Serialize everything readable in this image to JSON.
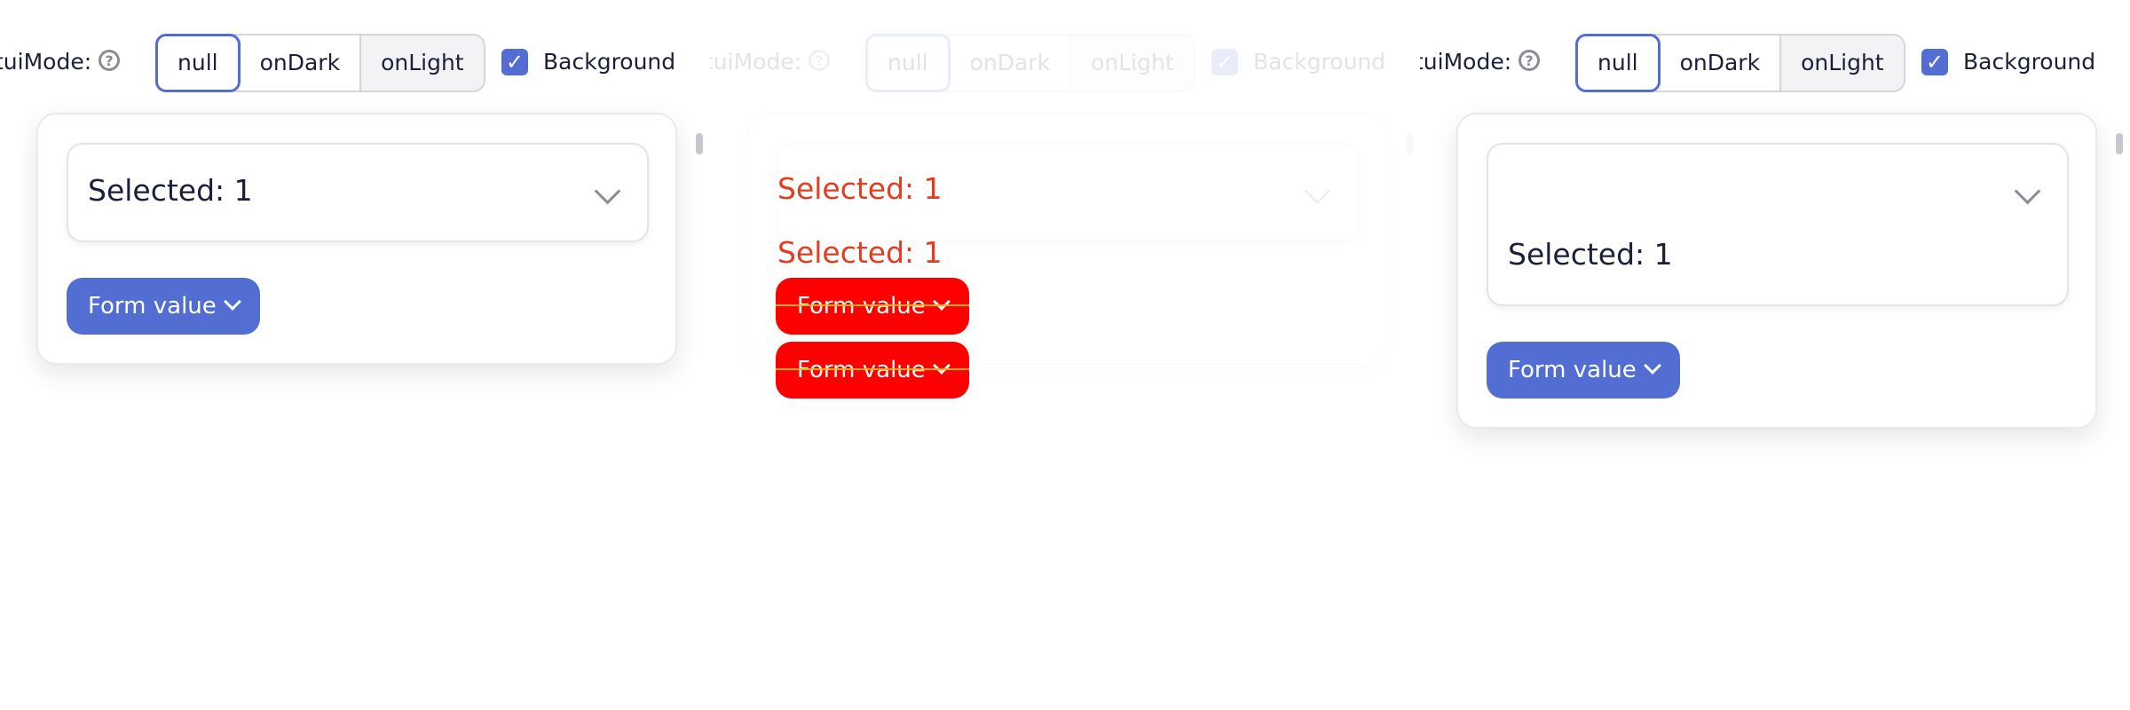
{
  "toolbar": {
    "label": "tuiMode:",
    "help_icon": "question-circle-icon",
    "options": [
      "null",
      "onDark",
      "onLight"
    ],
    "selected": "null",
    "background_checked": true,
    "background_label": "Background"
  },
  "panels": [
    {
      "select_value": "Selected: 1",
      "button_label": "Form value"
    },
    {
      "select_value": "Selected: 1",
      "button_label": "Form value"
    },
    {
      "select_value": "Selected: 1",
      "button_label": "Form value"
    }
  ],
  "colors": {
    "accent": "#526ed3",
    "diff_red": "#ff0000",
    "diff_text": "#e23d1f",
    "text": "#1b1f3b",
    "muted": "#8a8d96"
  }
}
